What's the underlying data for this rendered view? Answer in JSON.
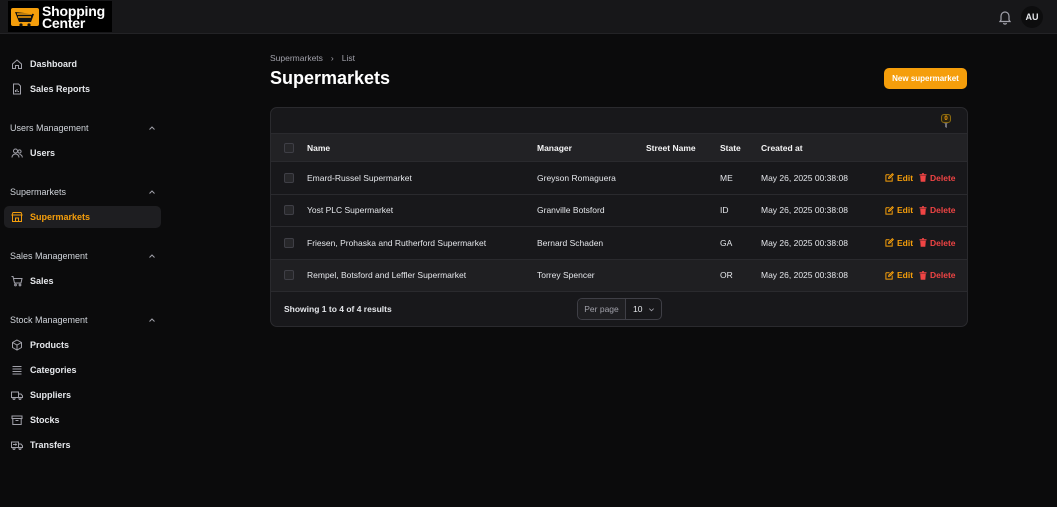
{
  "app": {
    "logo_line1": "Shopping",
    "logo_line2": "Center",
    "user_initials": "AU"
  },
  "sidebar": {
    "top_items": [
      {
        "label": "Dashboard",
        "icon": "home-icon"
      },
      {
        "label": "Sales Reports",
        "icon": "document-chart-icon"
      }
    ],
    "groups": [
      {
        "title": "Users Management",
        "items": [
          {
            "label": "Users",
            "icon": "users-icon"
          }
        ]
      },
      {
        "title": "Supermarkets",
        "items": [
          {
            "label": "Supermarkets",
            "icon": "store-icon",
            "active": true
          }
        ]
      },
      {
        "title": "Sales Management",
        "items": [
          {
            "label": "Sales",
            "icon": "cart-icon"
          }
        ]
      },
      {
        "title": "Stock Management",
        "items": [
          {
            "label": "Products",
            "icon": "cube-icon"
          },
          {
            "label": "Categories",
            "icon": "list-icon"
          },
          {
            "label": "Suppliers",
            "icon": "truck-icon"
          },
          {
            "label": "Stocks",
            "icon": "archive-icon"
          },
          {
            "label": "Transfers",
            "icon": "transfer-truck-icon"
          }
        ]
      }
    ]
  },
  "breadcrumb": {
    "parent": "Supermarkets",
    "separator": "›",
    "current": "List"
  },
  "page": {
    "title": "Supermarkets",
    "new_button": "New supermarket"
  },
  "table": {
    "filter_count": "0",
    "columns": {
      "name": "Name",
      "manager": "Manager",
      "street": "Street Name",
      "state": "State",
      "created": "Created at"
    },
    "rows": [
      {
        "name": "Emard-Russel Supermarket",
        "manager": "Greyson Romaguera",
        "street": "",
        "state": "ME",
        "created": "May 26, 2025 00:38:08"
      },
      {
        "name": "Yost PLC Supermarket",
        "manager": "Granville Botsford",
        "street": "",
        "state": "ID",
        "created": "May 26, 2025 00:38:08"
      },
      {
        "name": "Friesen, Prohaska and Rutherford Supermarket",
        "manager": "Bernard Schaden",
        "street": "",
        "state": "GA",
        "created": "May 26, 2025 00:38:08"
      },
      {
        "name": "Rempel, Botsford and Leffler Supermarket",
        "manager": "Torrey Spencer",
        "street": "",
        "state": "OR",
        "created": "May 26, 2025 00:38:08"
      }
    ],
    "edit_label": "Edit",
    "delete_label": "Delete",
    "footer": {
      "showing": "Showing 1 to 4 of 4 results",
      "per_page_label": "Per page",
      "per_page_value": "10"
    }
  },
  "colors": {
    "accent": "#f59e0b",
    "danger": "#ef4444",
    "background": "#0b0b0c",
    "surface": "#18181b"
  }
}
